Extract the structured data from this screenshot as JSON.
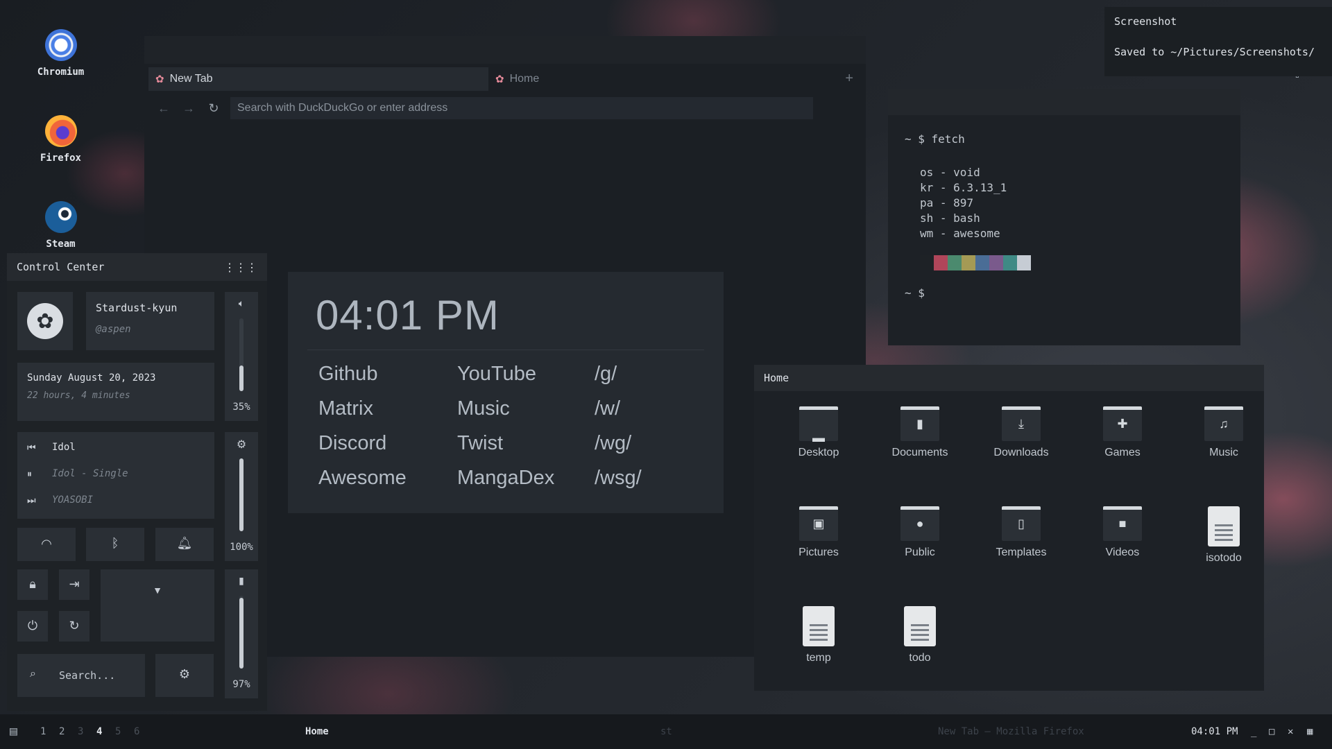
{
  "desktop": {
    "icons": [
      {
        "label": "Chromium"
      },
      {
        "label": "Firefox"
      },
      {
        "label": "Steam"
      }
    ]
  },
  "browser": {
    "tabs": [
      {
        "label": "New Tab",
        "active": true
      },
      {
        "label": "Home",
        "active": false
      }
    ],
    "new_tab_glyph": "+",
    "address_placeholder": "Search with DuckDuckGo or enter address",
    "startpage": {
      "clock": "04:01 PM",
      "links": [
        [
          "Github",
          "YouTube",
          "/g/"
        ],
        [
          "Matrix",
          "Music",
          "/w/"
        ],
        [
          "Discord",
          "Twist",
          "/wg/"
        ],
        [
          "Awesome",
          "MangaDex",
          "/wsg/"
        ]
      ]
    }
  },
  "notification": {
    "title": "Screenshot",
    "body": "Saved to ~/Pictures/Screenshots/"
  },
  "terminal": {
    "command": "~ $ fetch",
    "rows": [
      {
        "key": "os",
        "value": "void"
      },
      {
        "key": "kr",
        "value": "6.3.13_1"
      },
      {
        "key": "pa",
        "value": "897"
      },
      {
        "key": "sh",
        "value": "bash"
      },
      {
        "key": "wm",
        "value": "awesome"
      }
    ],
    "prompt": "~ $",
    "palette": [
      "#1e2226",
      "#b0465a",
      "#4b8a6e",
      "#a49a55",
      "#4a6d96",
      "#7a5a8c",
      "#3f8a85",
      "#c6ccd4"
    ]
  },
  "control_center": {
    "title": "Control Center",
    "user": {
      "name": "Stardust-kyun",
      "handle": "@aspen"
    },
    "date": "Sunday August 20, 2023",
    "uptime": "22 hours, 4 minutes",
    "music": {
      "title": "Idol",
      "album": "Idol - Single",
      "artist": "YOASOBI"
    },
    "volume": {
      "percent_label": "35%",
      "level": 0.35
    },
    "brightness": {
      "percent_label": "100%",
      "level": 1.0
    },
    "battery": {
      "percent_label": "97%",
      "level": 0.97
    },
    "search_placeholder": "Search..."
  },
  "file_manager": {
    "title": "Home",
    "items": [
      {
        "label": "Desktop",
        "kind": "folder",
        "icon": "desktop-icon"
      },
      {
        "label": "Documents",
        "kind": "folder",
        "icon": "document-icon"
      },
      {
        "label": "Downloads",
        "kind": "folder",
        "icon": "download-icon"
      },
      {
        "label": "Games",
        "kind": "folder",
        "icon": "gamepad-icon"
      },
      {
        "label": "Music",
        "kind": "folder",
        "icon": "music-note-icon"
      },
      {
        "label": "Pictures",
        "kind": "folder",
        "icon": "image-icon"
      },
      {
        "label": "Public",
        "kind": "folder",
        "icon": "person-icon"
      },
      {
        "label": "Templates",
        "kind": "folder",
        "icon": "template-icon"
      },
      {
        "label": "Videos",
        "kind": "folder",
        "icon": "video-icon"
      },
      {
        "label": "isotodo",
        "kind": "file",
        "icon": "text-file-icon"
      },
      {
        "label": "temp",
        "kind": "file",
        "icon": "text-file-icon"
      },
      {
        "label": "todo",
        "kind": "file",
        "icon": "text-file-icon"
      }
    ]
  },
  "taskbar": {
    "workspaces": [
      "1",
      "2",
      "3",
      "4",
      "5",
      "6"
    ],
    "active_workspace": "4",
    "tasks": [
      "Home",
      "st",
      "New Tab — Mozilla Firefox"
    ],
    "clock": "04:01 PM"
  }
}
